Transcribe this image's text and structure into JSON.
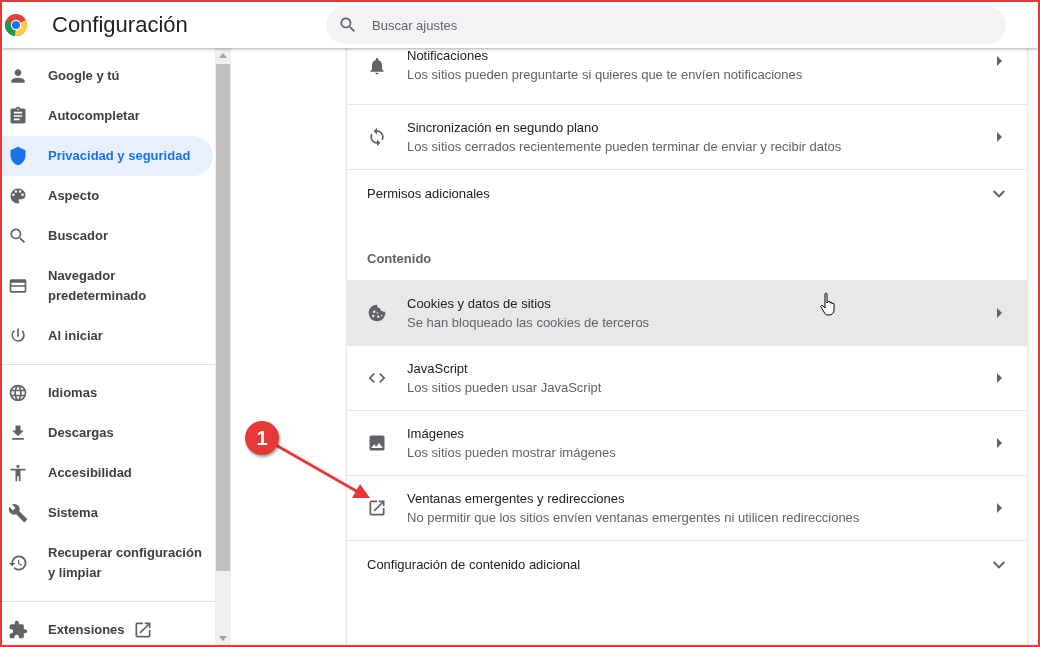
{
  "header": {
    "title": "Configuración",
    "search": {
      "placeholder": "Buscar ajustes"
    }
  },
  "sidebar": {
    "groups": [
      [
        {
          "label": "Google y tú",
          "selected": false,
          "external": false
        },
        {
          "label": "Autocompletar",
          "selected": false,
          "external": false
        },
        {
          "label": "Privacidad y seguridad",
          "selected": true,
          "external": false
        },
        {
          "label": "Aspecto",
          "selected": false,
          "external": false
        },
        {
          "label": "Buscador",
          "selected": false,
          "external": false
        },
        {
          "label": "Navegador predeterminado",
          "selected": false,
          "external": false
        },
        {
          "label": "Al iniciar",
          "selected": false,
          "external": false
        }
      ],
      [
        {
          "label": "Idiomas",
          "selected": false,
          "external": false
        },
        {
          "label": "Descargas",
          "selected": false,
          "external": false
        },
        {
          "label": "Accesibilidad",
          "selected": false,
          "external": false
        },
        {
          "label": "Sistema",
          "selected": false,
          "external": false
        },
        {
          "label": "Recuperar configuración y limpiar",
          "selected": false,
          "external": false
        }
      ],
      [
        {
          "label": "Extensiones",
          "selected": false,
          "external": true
        }
      ]
    ]
  },
  "content": {
    "blocks": [
      {
        "kind": "row",
        "title": "Notificaciones",
        "subtitle": "Los sitios pueden preguntarte si quieres que te envíen notificaciones",
        "hovered": false
      },
      {
        "kind": "row",
        "title": "Sincronización en segundo plano",
        "subtitle": "Los sitios cerrados recientemente pueden terminar de enviar y recibir datos",
        "hovered": false
      },
      {
        "kind": "expander",
        "title": "Permisos adicionales"
      },
      {
        "kind": "heading",
        "title": "Contenido"
      },
      {
        "kind": "row",
        "title": "Cookies y datos de sitios",
        "subtitle": "Se han bloqueado las cookies de terceros",
        "hovered": true
      },
      {
        "kind": "row",
        "title": "JavaScript",
        "subtitle": "Los sitios pueden usar JavaScript",
        "hovered": false
      },
      {
        "kind": "row",
        "title": "Imágenes",
        "subtitle": "Los sitios pueden mostrar imágenes",
        "hovered": false
      },
      {
        "kind": "row",
        "title": "Ventanas emergentes y redirecciones",
        "subtitle": "No permitir que los sitios envíen ventanas emergentes ni utilicen redirecciones",
        "hovered": false
      },
      {
        "kind": "expander",
        "title": "Configuración de contenido adicional"
      }
    ]
  },
  "annotation": {
    "label": "1"
  }
}
